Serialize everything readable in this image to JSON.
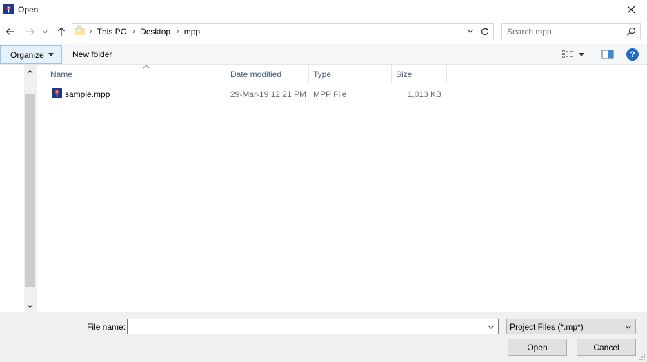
{
  "window": {
    "title": "Open"
  },
  "nav": {
    "breadcrumbs": [
      "This PC",
      "Desktop",
      "mpp"
    ],
    "search_placeholder": "Search mpp"
  },
  "toolbar": {
    "organize_label": "Organize",
    "new_folder_label": "New folder",
    "help_label": "?"
  },
  "file_list": {
    "columns": {
      "name": "Name",
      "date_modified": "Date modified",
      "type": "Type",
      "size": "Size"
    },
    "rows": [
      {
        "name": "sample.mpp",
        "date_modified": "29-Mar-19 12:21 PM",
        "type": "MPP File",
        "size": "1,013 KB"
      }
    ]
  },
  "footer": {
    "file_name_label": "File name:",
    "file_name_value": "",
    "file_type_selected": "Project Files (*.mp*)",
    "open_label": "Open",
    "cancel_label": "Cancel"
  },
  "colors": {
    "accent": "#1e6cc8",
    "organize_bg": "#e5f1fb",
    "header_text": "#4c607a",
    "secondary_text": "#6d6d6d",
    "footer_bg": "#f0f0f0"
  },
  "icons": [
    "project-app-icon",
    "close-icon",
    "back-arrow-icon",
    "forward-arrow-icon",
    "recent-locations-icon",
    "up-arrow-icon",
    "folder-icon",
    "chevron-down-icon",
    "refresh-icon",
    "search-icon",
    "view-options-icon",
    "preview-pane-icon",
    "help-icon",
    "sort-ascending-icon",
    "mpp-file-icon",
    "scroll-up-icon",
    "scroll-down-icon",
    "resize-grip-icon"
  ]
}
